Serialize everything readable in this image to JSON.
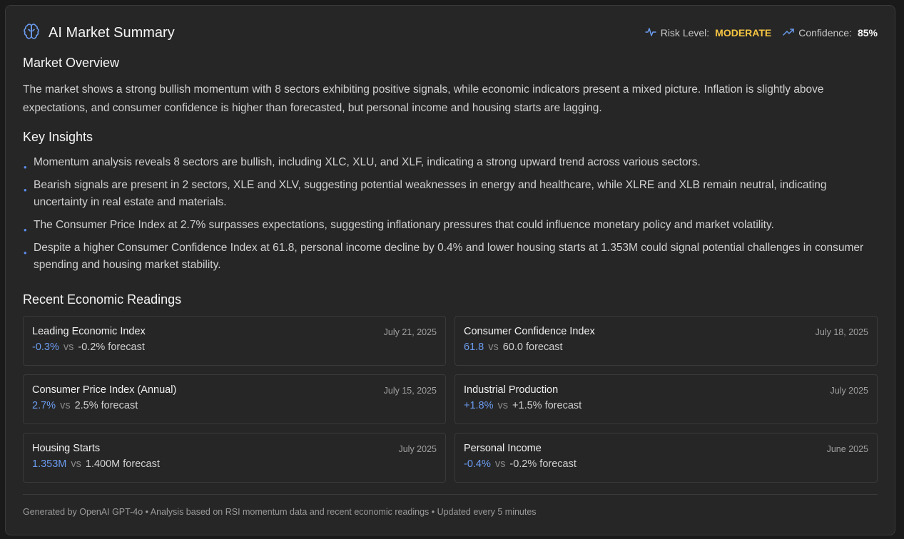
{
  "header": {
    "title": "AI Market Summary",
    "icon": "brain-icon",
    "risk_label": "Risk Level:",
    "risk_value": "MODERATE",
    "confidence_label": "Confidence:",
    "confidence_value": "85%"
  },
  "overview": {
    "title": "Market Overview",
    "text": "The market shows a strong bullish momentum with 8 sectors exhibiting positive signals, while economic indicators present a mixed picture. Inflation is slightly above expectations, and consumer confidence is higher than forecasted, but personal income and housing starts are lagging."
  },
  "insights": {
    "title": "Key Insights",
    "items": [
      "Momentum analysis reveals 8 sectors are bullish, including XLC, XLU, and XLF, indicating a strong upward trend across various sectors.",
      "Bearish signals are present in 2 sectors, XLE and XLV, suggesting potential weaknesses in energy and healthcare, while XLRE and XLB remain neutral, indicating uncertainty in real estate and materials.",
      "The Consumer Price Index at 2.7% surpasses expectations, suggesting inflationary pressures that could influence monetary policy and market volatility.",
      "Despite a higher Consumer Confidence Index at 61.8, personal income decline by 0.4% and lower housing starts at 1.353M could signal potential challenges in consumer spending and housing market stability."
    ]
  },
  "readings": {
    "title": "Recent Economic Readings",
    "vs_label": "vs",
    "items": [
      {
        "name": "Leading Economic Index",
        "date": "July 21, 2025",
        "actual": "-0.3%",
        "forecast": "-0.2% forecast"
      },
      {
        "name": "Consumer Confidence Index",
        "date": "July 18, 2025",
        "actual": "61.8",
        "forecast": "60.0 forecast"
      },
      {
        "name": "Consumer Price Index (Annual)",
        "date": "July 15, 2025",
        "actual": "2.7%",
        "forecast": "2.5% forecast"
      },
      {
        "name": "Industrial Production",
        "date": "July 2025",
        "actual": "+1.8%",
        "forecast": "+1.5% forecast"
      },
      {
        "name": "Housing Starts",
        "date": "July 2025",
        "actual": "1.353M",
        "forecast": "1.400M forecast"
      },
      {
        "name": "Personal Income",
        "date": "June 2025",
        "actual": "-0.4%",
        "forecast": "-0.2% forecast"
      }
    ]
  },
  "footer": {
    "text": "Generated by OpenAI GPT-4o • Analysis based on RSI momentum data and recent economic readings • Updated every 5 minutes"
  },
  "colors": {
    "accent_blue": "#6b9cf0",
    "risk_moderate": "#f5c542",
    "background": "#262626"
  }
}
